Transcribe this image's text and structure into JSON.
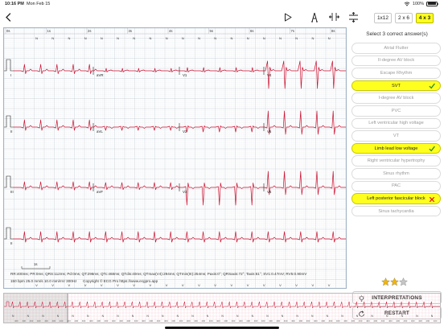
{
  "status_bar": {
    "time": "10:16 PM",
    "date": "Mon Feb 15",
    "battery": "100%"
  },
  "toolbar": {
    "back_icon": "chevron-left-icon",
    "play_icon": "play-icon",
    "caliper_icon": "caliper-icon",
    "measure_h_icon": "horizontal-caliper-icon",
    "measure_v_icon": "vertical-caliper-icon",
    "layouts": [
      {
        "label": "1x12",
        "active": false
      },
      {
        "label": "2 x 6",
        "active": false
      },
      {
        "label": "4 x 3",
        "active": true
      }
    ]
  },
  "ecg": {
    "time_marks": [
      "0s",
      "1s",
      "2s",
      "3s",
      "4s",
      "5s",
      "6s",
      "7s",
      "8s"
    ],
    "beat_label": "N",
    "beat_label_bottom": "V",
    "lead_labels": {
      "row1": [
        "I",
        "aVR",
        "V1",
        "V4"
      ],
      "row2": [
        "II",
        "aVL",
        "V2",
        "V5"
      ],
      "row3": [
        "III",
        "aVF",
        "V3",
        "V6"
      ],
      "row4": [
        "II"
      ]
    },
    "scale_label": "1s",
    "measurements": "RR:400ms; PR:0ms; QRS:112ms; Pd:0ms; QT:296ms; QTc:468ms; QTdis:40ms; QTmax(V4):294ms; QTmin(III):254ms; Paxis:0°; QRSaxis:72°; Taxis:61°; SV1:0.47mV; RV5:0.90mV",
    "settings": "150 bpm   25.0 mm/s  10.0 mm/mV  300Hz",
    "copyright": "Copyright © ECG Pro https://www.ecgpro.app",
    "colors": {
      "trace": "#cc1030",
      "grid": "#b9c3cc",
      "grid_minor": "#e6eaee",
      "border": "#9fb3c6"
    }
  },
  "panel": {
    "prompt": "Select 3 correct answer(s)",
    "answers": [
      {
        "label": "Atrial Flutter",
        "state": "none"
      },
      {
        "label": "II-degree AV block",
        "state": "none"
      },
      {
        "label": "Escape Rhythm",
        "state": "none"
      },
      {
        "label": "SVT",
        "state": "correct"
      },
      {
        "label": "I-degree AV block",
        "state": "none"
      },
      {
        "label": "PVC",
        "state": "none"
      },
      {
        "label": "Left ventricular high voltage",
        "state": "none"
      },
      {
        "label": "VT",
        "state": "none"
      },
      {
        "label": "Limb lead low voltage",
        "state": "correct"
      },
      {
        "label": "Right ventricular hypertrophy",
        "state": "none"
      },
      {
        "label": "Sinus rhythm",
        "state": "none"
      },
      {
        "label": "PAC",
        "state": "none"
      },
      {
        "label": "Left posterior fascicular block",
        "state": "wrong"
      },
      {
        "label": "Sinus tachycardia",
        "state": "none"
      }
    ],
    "rating": {
      "filled": 2,
      "total": 3
    },
    "interpretations_label": "INTERPRETATIONS",
    "interpretations_icon": "lightbulb-icon",
    "restart_label": "RESTART",
    "restart_icon": "refresh-icon",
    "colors": {
      "selected": "#ffff1f",
      "check": "#2a8a2a",
      "cross": "#e0201c",
      "star": "#f4b400",
      "star_empty": "#c5c5c5"
    }
  },
  "strip": {
    "beat_label": "N",
    "rr_label": "400"
  }
}
